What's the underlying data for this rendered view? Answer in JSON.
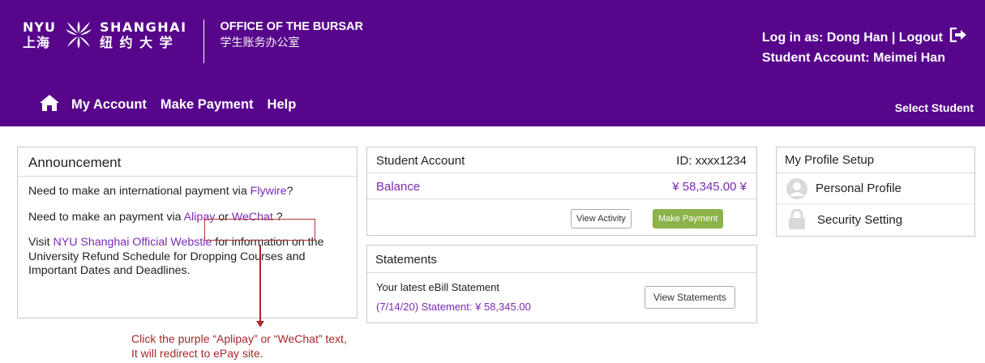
{
  "logo": {
    "nyu_line1": "NYU",
    "nyu_line2": "上海",
    "shanghai_line1": "SHANGHAI",
    "shanghai_line2": "纽 约 大 学",
    "office_title": "OFFICE OF THE BURSAR",
    "office_cn": "学生账务办公室"
  },
  "user": {
    "login_text": "Log in as: Dong Han | Logout",
    "student_account": "Student Account: Meimei Han"
  },
  "nav": {
    "items": [
      "My Account",
      "Make Payment",
      "Help"
    ],
    "select_student": "Select Student"
  },
  "announcement": {
    "title": "Announcement",
    "line1_prefix": "Need to make an international payment via ",
    "line1_link": "Flywire",
    "line1_suffix": "?",
    "line2_prefix": "Need to make an payment via ",
    "line2_link1": "Alipay",
    "line2_mid": " or ",
    "line2_link2": "WeChat",
    "line2_suffix": " ?",
    "line3_prefix": "Visit ",
    "line3_link": "NYU Shanghai Official Webstie",
    "line3_rest": " for information on the University Refund Schedule for Dropping Courses and Important Dates and Deadlines."
  },
  "account": {
    "title": "Student Account",
    "id": "ID: xxxx1234",
    "balance_label": "Balance",
    "balance_value": "¥ 58,345.00 ¥",
    "view_activity": "View Activity",
    "make_payment": "Make Payment"
  },
  "statements": {
    "title": "Statements",
    "latest": "Your latest eBill Statement",
    "link": "(7/14/20) Statement: ¥ 58,345.00",
    "view_button": "View Statements"
  },
  "profile": {
    "title": "My Profile Setup",
    "personal": "Personal Profile",
    "security": "Security Setting"
  },
  "callout": {
    "line1": "Click the purple “Aplipay” or “WeChat” text,",
    "line2": "It will redirect to ePay site."
  },
  "colors": {
    "header_purple": "#57068c",
    "link_purple": "#7b2ab6",
    "button_green": "#8cb24a",
    "callout_red": "#a8272b"
  }
}
